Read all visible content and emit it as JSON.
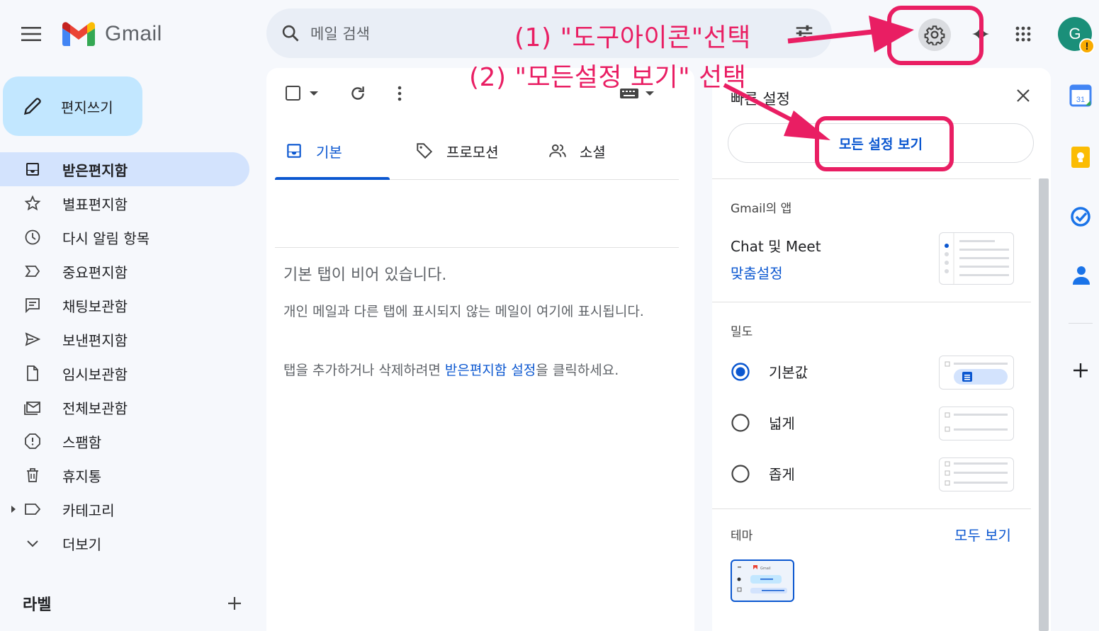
{
  "header": {
    "logo_text": "Gmail",
    "search_placeholder": "메일 검색",
    "avatar_letter": "G",
    "avatar_badge": "!"
  },
  "compose": {
    "label": "편지쓰기"
  },
  "nav": [
    {
      "label": "받은편지함",
      "icon": "inbox-icon",
      "active": true
    },
    {
      "label": "별표편지함",
      "icon": "star-icon"
    },
    {
      "label": "다시 알림 항목",
      "icon": "clock-icon"
    },
    {
      "label": "중요편지함",
      "icon": "important-icon"
    },
    {
      "label": "채팅보관함",
      "icon": "chat-icon"
    },
    {
      "label": "보낸편지함",
      "icon": "send-icon"
    },
    {
      "label": "임시보관함",
      "icon": "draft-icon"
    },
    {
      "label": "전체보관함",
      "icon": "all-mail-icon"
    },
    {
      "label": "스팸함",
      "icon": "spam-icon"
    },
    {
      "label": "휴지통",
      "icon": "trash-icon"
    },
    {
      "label": "카테고리",
      "icon": "label-icon"
    },
    {
      "label": "더보기",
      "icon": "chevron-down-icon"
    }
  ],
  "labels_section": {
    "title": "라벨"
  },
  "tabs": [
    {
      "label": "기본",
      "icon": "inbox-icon",
      "active": true
    },
    {
      "label": "프로모션",
      "icon": "tag-icon"
    },
    {
      "label": "소셜",
      "icon": "people-icon"
    }
  ],
  "empty_state": {
    "title": "기본 탭이 비어 있습니다.",
    "desc": "개인 메일과 다른 탭에 표시되지 않는 메일이 여기에 표시됩니다.",
    "link_prefix": "탭을 추가하거나 삭제하려면 ",
    "link_text": "받은편지함 설정",
    "link_suffix": "을 클릭하세요."
  },
  "quick_settings": {
    "title": "빠른 설정",
    "all_settings_button": "모든 설정 보기",
    "apps_heading": "Gmail의 앱",
    "chat_meet": "Chat 및 Meet",
    "customize": "맞춤설정",
    "density_heading": "밀도",
    "density_options": [
      {
        "label": "기본값",
        "selected": true
      },
      {
        "label": "넓게",
        "selected": false
      },
      {
        "label": "좁게",
        "selected": false
      }
    ],
    "theme_heading": "테마",
    "theme_view_all": "모두 보기",
    "theme_thumb_logo": "Gmail"
  },
  "side_apps": {
    "calendar_day": "31"
  },
  "annotations": {
    "step1": "(1) \"도구아이콘\"선택",
    "step2": "(2) \"모든설정 보기\" 선택"
  },
  "colors": {
    "accent": "#0b57d0",
    "annotation": "#e91e63",
    "active_nav": "#d3e3fd",
    "compose": "#c2e7ff"
  }
}
